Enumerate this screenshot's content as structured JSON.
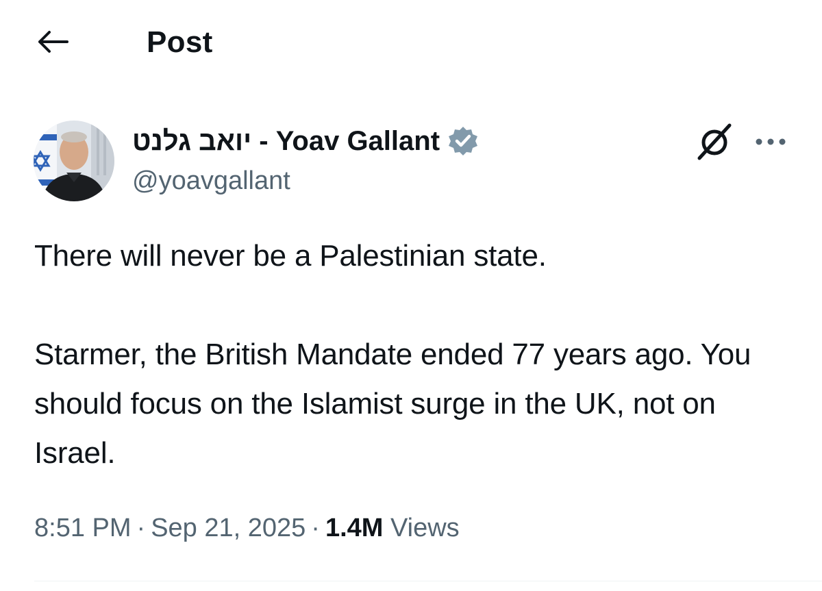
{
  "header": {
    "title": "Post",
    "back_icon": "arrow-left-icon"
  },
  "author": {
    "display_name": "יואב גלנט - Yoav Gallant",
    "handle": "@yoavgallant",
    "verified_icon": "verified-badge-icon",
    "verified_color": "#829aab"
  },
  "actions": {
    "grok_icon": "grok-icon",
    "more_icon": "more-horizontal-icon"
  },
  "post": {
    "paragraph_1": "There will never be a Palestinian state.",
    "paragraph_2": "Starmer, the British Mandate ended 77 years ago. You should focus on the Islamist surge in the UK, not on Israel."
  },
  "meta": {
    "time": "8:51 PM",
    "separator": "·",
    "date": "Sep 21, 2025",
    "views_count": "1.4M",
    "views_label": "Views"
  },
  "colors": {
    "text_primary": "#0f1419",
    "text_secondary": "#536471",
    "divider": "#eff3f4"
  }
}
